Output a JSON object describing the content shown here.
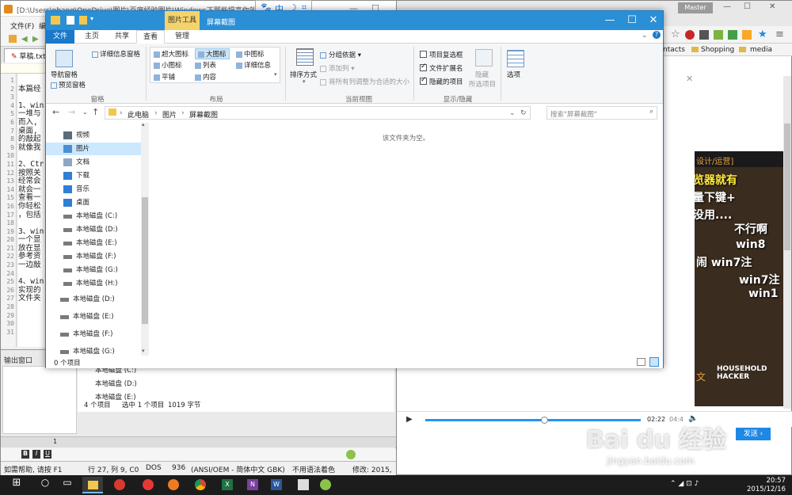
{
  "screenshot_tool": {
    "label_1": "中"
  },
  "editor": {
    "title": "[D:\\Users\\phang\\OneDrive\\图片\\百度经验图片\\Windows下那些提高你效率的快",
    "menu": {
      "file": "文件(F)",
      "edit": "编"
    },
    "tab_label": "草稿.txt",
    "line_numbers": [
      "1",
      "2",
      "3",
      "4",
      "5",
      "6",
      "7",
      "8",
      "9",
      "10",
      "11",
      "12",
      "13",
      "14",
      "15",
      "16",
      "17",
      "18",
      "19",
      "20",
      "21",
      "22",
      "23",
      "24",
      "25",
      "26",
      "27",
      "28",
      "29",
      "30",
      "31"
    ],
    "code_lines": [
      "",
      "本篇经",
      "",
      "1、win",
      "一堆与",
      "而入,",
      "桌面,",
      "的敲起",
      "就像我",
      "",
      "2、Ctr",
      "按照关",
      "经常会",
      "就会一",
      "查看一",
      "你轻松",
      "，包括",
      "",
      "3、win",
      "一个显",
      "放在显",
      "参考资",
      "一边敲",
      "",
      "4、win",
      "实现的",
      "文件夹",
      "",
      "",
      "",
      ""
    ],
    "output_label": "输出窗口",
    "page_tab": "1",
    "status": {
      "help": "如需帮助, 请按 F1",
      "pos": "行 27, 列 9, C0",
      "format": "DOS",
      "codepage": "936",
      "encoding": "(ANSI/OEM - 简体中文 GBK)",
      "syntax": "不用语法着色",
      "modified": "修改: 2015,"
    }
  },
  "browser": {
    "profile": "Master",
    "bookmarks": [
      "ntacts",
      "Shopping",
      "media"
    ],
    "video": {
      "header": "设计/运营]",
      "captions": [
        "览器就有",
        "量下键+",
        "没用....",
        "不行啊",
        "win8",
        "闹   win7注",
        "win7注",
        "win1"
      ],
      "brand": "HOUSEHOLD HACKER",
      "side_text": "文"
    },
    "player_time": "02:22",
    "player_time_total": "04:4",
    "send_button": "发送 ›"
  },
  "explorer": {
    "context_tab": "图片工具",
    "title": "屏幕截图",
    "window_buttons": {
      "minimize": "—",
      "maximize": "☐",
      "close": "✕"
    },
    "ribbon_tabs": {
      "file": "文件",
      "home": "主页",
      "share": "共享",
      "view": "查看",
      "manage": "管理"
    },
    "pane_group": {
      "nav_pane": "导航窗格",
      "preview_pane": "预览窗格",
      "details_pane": "详细信息窗格",
      "label": "窗格"
    },
    "layout_group": {
      "extra_large": "超大图标",
      "large": "大图标",
      "medium": "中图标",
      "small": "小图标",
      "list": "列表",
      "details": "详细信息",
      "tiles": "平铺",
      "content": "内容",
      "label": "布局"
    },
    "current_view_group": {
      "sort_by": "排序方式",
      "group_by": "分组依据",
      "add_columns": "添加列",
      "fit_columns": "将所有列调整为合适的大小",
      "label": "当前视图"
    },
    "show_hide_group": {
      "item_checkboxes": "项目复选框",
      "file_extensions": "文件扩展名",
      "hidden_items": "隐藏的项目",
      "hide": "隐藏",
      "selected_items": "所选项目",
      "label": "显示/隐藏"
    },
    "options": "选项",
    "breadcrumb": [
      "此电脑",
      "图片",
      "屏幕截图"
    ],
    "search_placeholder": "搜索\"屏幕截图\"",
    "nav_items": [
      {
        "label": "视频",
        "icon": "video-icon"
      },
      {
        "label": "图片",
        "icon": "pictures-icon"
      },
      {
        "label": "文档",
        "icon": "documents-icon"
      },
      {
        "label": "下载",
        "icon": "downloads-icon"
      },
      {
        "label": "音乐",
        "icon": "music-icon"
      },
      {
        "label": "桌面",
        "icon": "desktop-icon"
      },
      {
        "label": "本地磁盘 (C:)",
        "icon": "drive-icon"
      },
      {
        "label": "本地磁盘 (D:)",
        "icon": "drive-icon"
      },
      {
        "label": "本地磁盘 (E:)",
        "icon": "drive-icon"
      },
      {
        "label": "本地磁盘 (F:)",
        "icon": "drive-icon"
      },
      {
        "label": "本地磁盘 (G:)",
        "icon": "drive-icon"
      },
      {
        "label": "本地磁盘 (H:)",
        "icon": "drive-icon"
      },
      {
        "label": "本地磁盘 (D:)",
        "icon": "drive-icon"
      },
      {
        "label": "本地磁盘 (E:)",
        "icon": "drive-icon"
      },
      {
        "label": "本地磁盘 (F:)",
        "icon": "drive-icon"
      },
      {
        "label": "本地磁盘 (G:)",
        "icon": "drive-icon"
      }
    ],
    "empty_text": "该文件夹为空。",
    "status_count": "0 个项目"
  },
  "background_explorer": {
    "drives": [
      "本地磁盘 (C:)",
      "本地磁盘 (D:)",
      "本地磁盘 (E:)"
    ],
    "status_items": "4 个项目",
    "status_selected": "选中 1 个项目",
    "status_size": "1019 字节"
  },
  "taskbar": {
    "time": "20:57",
    "date": "2015/12/16"
  },
  "watermark": {
    "brand": "Bai du 经验",
    "url": "jingyan.baidu.com"
  }
}
